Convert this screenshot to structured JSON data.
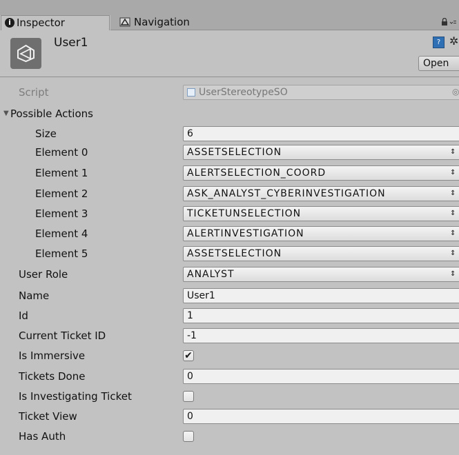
{
  "tabs": [
    {
      "label": "Inspector",
      "icon": "info-icon",
      "active": true
    },
    {
      "label": "Navigation",
      "icon": "navigation-icon",
      "active": false
    }
  ],
  "header": {
    "title": "User1",
    "open_label": "Open"
  },
  "script": {
    "label": "Script",
    "value": "UserStereotypeSO"
  },
  "possible_actions": {
    "label": "Possible Actions",
    "size_label": "Size",
    "size_value": "6",
    "elements": [
      {
        "label": "Element 0",
        "value": "ASSETSELECTION"
      },
      {
        "label": "Element 1",
        "value": "ALERTSELECTION_COORD"
      },
      {
        "label": "Element 2",
        "value": "ASK_ANALYST_CYBERINVESTIGATION"
      },
      {
        "label": "Element 3",
        "value": "TICKETUNSELECTION"
      },
      {
        "label": "Element 4",
        "value": "ALERTINVESTIGATION"
      },
      {
        "label": "Element 5",
        "value": "ASSETSELECTION"
      }
    ]
  },
  "fields": {
    "user_role": {
      "label": "User Role",
      "value": "ANALYST"
    },
    "name": {
      "label": "Name",
      "value": "User1"
    },
    "id": {
      "label": "Id",
      "value": "1"
    },
    "current_ticket_id": {
      "label": "Current Ticket ID",
      "value": "-1"
    },
    "is_immersive": {
      "label": "Is Immersive",
      "checked": true
    },
    "tickets_done": {
      "label": "Tickets Done",
      "value": "0"
    },
    "is_investigating_ticket": {
      "label": "Is Investigating Ticket",
      "checked": false
    },
    "ticket_view": {
      "label": "Ticket View",
      "value": "0"
    },
    "has_auth": {
      "label": "Has Auth",
      "checked": false
    }
  },
  "glyphs": {
    "info": "i",
    "dropdown_arrow": "⇕",
    "checkmark": "✔",
    "foldout": "▼",
    "gear": "✲",
    "lock": "🔒︎",
    "target": "◎",
    "book": "?"
  }
}
